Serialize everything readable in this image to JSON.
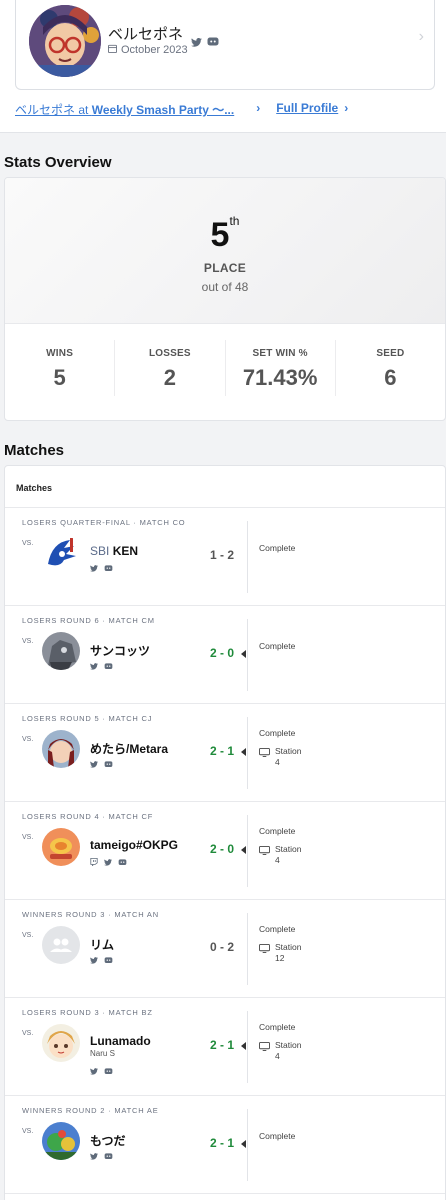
{
  "profile": {
    "name": "ベルセポネ",
    "joined": "October 2023",
    "links": {
      "player_prefix": "ベルセポネ",
      "at": " at ",
      "event": "Weekly Smash Party ～...",
      "full_profile": "Full Profile"
    }
  },
  "stats": {
    "title": "Stats Overview",
    "place": "5",
    "place_suffix": "th",
    "place_label": "PLACE",
    "out_of": "out of 48",
    "items": [
      {
        "label": "WINS",
        "value": "5"
      },
      {
        "label": "LOSSES",
        "value": "2"
      },
      {
        "label": "SET WIN %",
        "value": "71.43%"
      },
      {
        "label": "SEED",
        "value": "6"
      }
    ]
  },
  "matches": {
    "title": "Matches",
    "header": "Matches",
    "vs_label": "VS.",
    "list": [
      {
        "round": "LOSERS QUARTER-FINAL · MATCH CO",
        "prefix": "SBI",
        "name": "KEN",
        "sub": "",
        "score": "1 - 2",
        "win": false,
        "status": "Complete",
        "station": "",
        "station_num": "",
        "icons": [
          "twitter-icon",
          "discord-icon"
        ]
      },
      {
        "round": "LOSERS ROUND 6 · MATCH CM",
        "prefix": "",
        "name": "サンコッツ",
        "sub": "",
        "score": "2 - 0",
        "win": true,
        "status": "Complete",
        "station": "",
        "station_num": "",
        "icons": [
          "twitter-icon",
          "discord-icon"
        ]
      },
      {
        "round": "LOSERS ROUND 5 · MATCH CJ",
        "prefix": "",
        "name": "めたら/Metara",
        "sub": "",
        "score": "2 - 1",
        "win": true,
        "status": "Complete",
        "station": "Station",
        "station_num": "4",
        "icons": [
          "twitter-icon",
          "discord-icon"
        ]
      },
      {
        "round": "LOSERS ROUND 4 · MATCH CF",
        "prefix": "",
        "name": "tameigo#OKPG",
        "sub": "",
        "score": "2 - 0",
        "win": true,
        "status": "Complete",
        "station": "Station",
        "station_num": "4",
        "icons": [
          "twitch-icon",
          "twitter-icon",
          "discord-icon"
        ]
      },
      {
        "round": "WINNERS ROUND 3 · MATCH AN",
        "prefix": "",
        "name": "リム",
        "sub": "",
        "score": "0 - 2",
        "win": false,
        "status": "Complete",
        "station": "Station",
        "station_num": "12",
        "icons": [
          "twitter-icon",
          "discord-icon"
        ]
      },
      {
        "round": "LOSERS ROUND 3 · MATCH BZ",
        "prefix": "",
        "name": "Lunamado",
        "sub": "Naru S",
        "score": "2 - 1",
        "win": true,
        "status": "Complete",
        "station": "Station",
        "station_num": "4",
        "icons": [
          "twitter-icon",
          "discord-icon"
        ]
      },
      {
        "round": "WINNERS ROUND 2 · MATCH AE",
        "prefix": "",
        "name": "もつだ",
        "sub": "",
        "score": "2 - 1",
        "win": true,
        "status": "Complete",
        "station": "",
        "station_num": "",
        "icons": [
          "twitter-icon",
          "discord-icon"
        ]
      }
    ]
  },
  "colors": {
    "link": "#3a7bd5",
    "win": "#1f8a3a",
    "muted": "#555555"
  }
}
